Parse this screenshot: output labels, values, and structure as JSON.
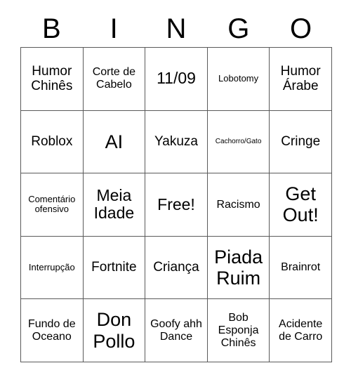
{
  "header": {
    "letters": [
      "B",
      "I",
      "N",
      "G",
      "O"
    ]
  },
  "grid": {
    "rows": [
      [
        {
          "label": "Humor Chinês",
          "size": "lg"
        },
        {
          "label": "Corte de Cabelo",
          "size": "md"
        },
        {
          "label": "11/09",
          "size": "xl"
        },
        {
          "label": "Lobotomy",
          "size": "sm"
        },
        {
          "label": "Humor Árabe",
          "size": "lg"
        }
      ],
      [
        {
          "label": "Roblox",
          "size": "lg"
        },
        {
          "label": "AI",
          "size": "xxl"
        },
        {
          "label": "Yakuza",
          "size": "lg"
        },
        {
          "label": "Cachorro/Gato",
          "size": "xs"
        },
        {
          "label": "Cringe",
          "size": "lg"
        }
      ],
      [
        {
          "label": "Comentário ofensivo",
          "size": "sm"
        },
        {
          "label": "Meia Idade",
          "size": "xl"
        },
        {
          "label": "Free!",
          "size": "xl"
        },
        {
          "label": "Racismo",
          "size": "md"
        },
        {
          "label": "Get Out!",
          "size": "xxl"
        }
      ],
      [
        {
          "label": "Interrupção",
          "size": "sm"
        },
        {
          "label": "Fortnite",
          "size": "lg"
        },
        {
          "label": "Criança",
          "size": "lg"
        },
        {
          "label": "Piada Ruim",
          "size": "xxl"
        },
        {
          "label": "Brainrot",
          "size": "md"
        }
      ],
      [
        {
          "label": "Fundo de Oceano",
          "size": "md"
        },
        {
          "label": "Don Pollo",
          "size": "xxl"
        },
        {
          "label": "Goofy ahh Dance",
          "size": "md"
        },
        {
          "label": "Bob Esponja Chinês",
          "size": "md"
        },
        {
          "label": "Acidente de Carro",
          "size": "md"
        }
      ]
    ]
  },
  "colors": {
    "background": "#ffffff",
    "text": "#000000",
    "border": "#5a5a5a"
  }
}
